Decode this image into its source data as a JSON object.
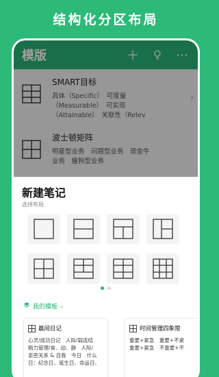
{
  "promo": {
    "title": "结构化分区布局"
  },
  "background_app": {
    "title": "模版",
    "icons": [
      "plus-icon",
      "lightbulb-icon",
      "more-icon"
    ],
    "templates": [
      {
        "name": "SMART目标",
        "desc_lines": [
          "具体（Specific）　可度量",
          "（Measurable）　可实现",
          "（Attainable）　关联性（Relev"
        ]
      },
      {
        "name": "波士顿矩阵",
        "desc_lines": [
          "明星型业务　问题型业务　现金牛",
          "业务　瘦狗型业务"
        ]
      }
    ]
  },
  "sheet": {
    "title": "新建笔记",
    "subtitle": "选择布局",
    "layouts": [
      "single",
      "two-rows",
      "top-plus-two",
      "left-plus-two-right",
      "four-grid",
      "top-two-plus-bottom",
      "six-grid",
      "nine-grid"
    ],
    "page_count": 2,
    "active_page": 0,
    "my_templates_label": "我的模板",
    "cards": [
      {
        "title": "晨间日记",
        "lines": [
          "心灵/成功日记　人际/弱连结",
          "精力管理/食、动、静　人际/",
          "亲密关系 & 自我　今日　什么",
          "日：纪念日、诞生日、命运日、"
        ]
      },
      {
        "title": "时间管理四象限",
        "lines": [
          "重要+紧急　重要+不紧",
          "重要+紧急　不重要+不"
        ]
      }
    ]
  },
  "colors": {
    "accent": "#2db978",
    "dot_inactive": "#d8d8d8"
  }
}
